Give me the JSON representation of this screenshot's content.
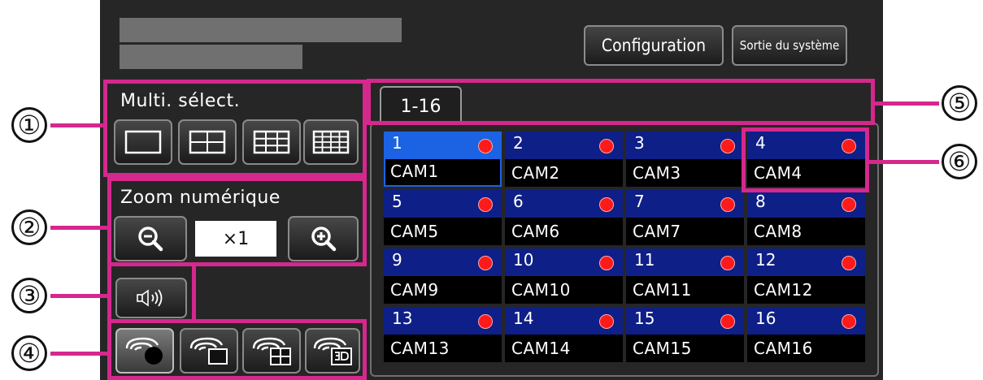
{
  "header": {
    "configuration_label": "Configuration",
    "exit_label": "Sortie du système"
  },
  "multi_select": {
    "label": "Multi. sélect."
  },
  "zoom": {
    "label": "Zoom numérique",
    "value": "×1"
  },
  "tabs": [
    {
      "label": "1-16",
      "active": true
    }
  ],
  "callouts": [
    "①",
    "②",
    "③",
    "④",
    "⑤",
    "⑥"
  ],
  "cameras": [
    {
      "num": "1",
      "name": "CAM1",
      "selected": true
    },
    {
      "num": "2",
      "name": "CAM2"
    },
    {
      "num": "3",
      "name": "CAM3"
    },
    {
      "num": "4",
      "name": "CAM4"
    },
    {
      "num": "5",
      "name": "CAM5"
    },
    {
      "num": "6",
      "name": "CAM6"
    },
    {
      "num": "7",
      "name": "CAM7"
    },
    {
      "num": "8",
      "name": "CAM8"
    },
    {
      "num": "9",
      "name": "CAM9"
    },
    {
      "num": "10",
      "name": "CAM10"
    },
    {
      "num": "11",
      "name": "CAM11"
    },
    {
      "num": "12",
      "name": "CAM12"
    },
    {
      "num": "13",
      "name": "CAM13"
    },
    {
      "num": "14",
      "name": "CAM14"
    },
    {
      "num": "15",
      "name": "CAM15"
    },
    {
      "num": "16",
      "name": "CAM16"
    }
  ],
  "icons": {
    "multi_select": [
      "single-screen-icon",
      "quad-screen-icon",
      "nine-screen-icon",
      "sixteen-screen-icon"
    ],
    "zoom_out": "zoom-out-icon",
    "zoom_in": "zoom-in-icon",
    "audio": "speaker-icon",
    "display_modes": [
      "fisheye-single-icon",
      "fisheye-panorama-icon",
      "fisheye-quad-icon",
      "fisheye-3d-icon"
    ]
  },
  "colors": {
    "callout_frame": "#d5288d",
    "camera_tile": "#0e1f87",
    "camera_tile_selected": "#1b63e2",
    "recording_dot": "#ff1a1a",
    "panel_background": "#262626"
  }
}
